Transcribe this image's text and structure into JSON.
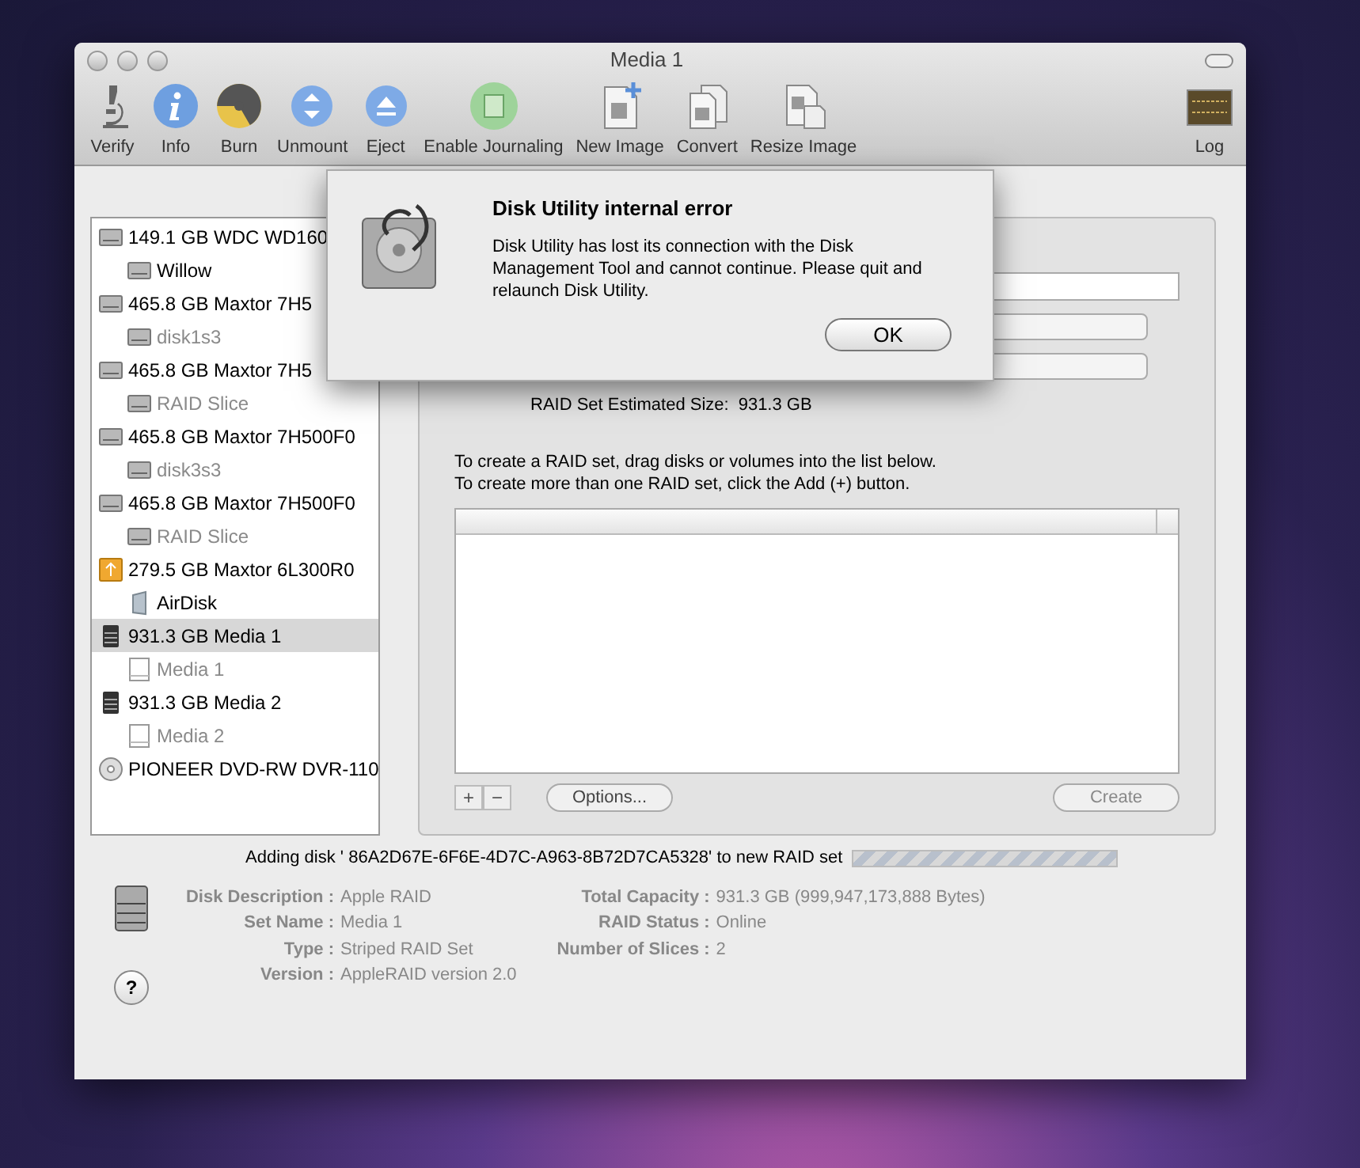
{
  "window": {
    "title": "Media 1"
  },
  "toolbar": [
    {
      "label": "Verify",
      "kind": "microscope"
    },
    {
      "label": "Info",
      "kind": "info"
    },
    {
      "label": "Burn",
      "kind": "burn"
    },
    {
      "label": "Unmount",
      "kind": "unmount"
    },
    {
      "label": "Eject",
      "kind": "eject"
    },
    {
      "label": "Enable Journaling",
      "kind": "journal"
    },
    {
      "label": "New Image",
      "kind": "newimage"
    },
    {
      "label": "Convert",
      "kind": "convert"
    },
    {
      "label": "Resize Image",
      "kind": "resize"
    }
  ],
  "log_button": {
    "label": "Log"
  },
  "sidebar": {
    "items": [
      {
        "label": "149.1 GB WDC WD160",
        "kind": "disk",
        "selected": false,
        "dimmed": false,
        "children": [
          {
            "label": "Willow",
            "kind": "disk",
            "selected": false,
            "dimmed": false
          }
        ]
      },
      {
        "label": "465.8 GB Maxtor 7H5",
        "kind": "disk",
        "selected": false,
        "dimmed": false,
        "children": [
          {
            "label": "disk1s3",
            "kind": "disk",
            "selected": false,
            "dimmed": true
          }
        ]
      },
      {
        "label": "465.8 GB Maxtor 7H5",
        "kind": "disk",
        "selected": false,
        "dimmed": false,
        "children": [
          {
            "label": "RAID Slice",
            "kind": "disk",
            "selected": false,
            "dimmed": true
          }
        ]
      },
      {
        "label": "465.8 GB Maxtor 7H500F0",
        "kind": "disk",
        "selected": false,
        "dimmed": false,
        "children": [
          {
            "label": "disk3s3",
            "kind": "disk",
            "selected": false,
            "dimmed": true
          }
        ]
      },
      {
        "label": "465.8 GB Maxtor 7H500F0",
        "kind": "disk",
        "selected": false,
        "dimmed": false,
        "children": [
          {
            "label": "RAID Slice",
            "kind": "disk",
            "selected": false,
            "dimmed": true
          }
        ]
      },
      {
        "label": "279.5 GB Maxtor 6L300R0",
        "kind": "firewire",
        "selected": false,
        "dimmed": false,
        "children": [
          {
            "label": "AirDisk",
            "kind": "network",
            "selected": false,
            "dimmed": false
          }
        ]
      },
      {
        "label": "931.3 GB Media 1",
        "kind": "raid",
        "selected": true,
        "dimmed": false,
        "children": [
          {
            "label": "Media 1",
            "kind": "volume",
            "selected": false,
            "dimmed": true
          }
        ]
      },
      {
        "label": "931.3 GB Media 2",
        "kind": "raid",
        "selected": false,
        "dimmed": false,
        "children": [
          {
            "label": "Media 2",
            "kind": "volume",
            "selected": false,
            "dimmed": true
          }
        ]
      },
      {
        "label": "PIONEER DVD-RW DVR-110",
        "kind": "optical",
        "selected": false,
        "dimmed": false
      }
    ]
  },
  "raid_panel": {
    "estimated_size_label": "RAID Set Estimated Size:",
    "estimated_size": "931.3 GB",
    "instructions": [
      "To create a RAID set, drag disks or volumes into the list below.",
      "To create more than one RAID set, click the Add (+) button."
    ],
    "add_button": "+",
    "remove_button": "−",
    "options_button": {
      "label": "Options...",
      "disabled": false
    },
    "create_button": {
      "label": "Create",
      "disabled": true
    }
  },
  "dialog": {
    "title": "Disk Utility internal error",
    "message": "Disk Utility has lost its connection with the Disk Management Tool and cannot continue. Please quit and relaunch Disk Utility.",
    "button": "OK"
  },
  "status": {
    "message": "Adding disk ' 86A2D67E-6F6E-4D7C-A963-8B72D7CA5328' to new RAID set",
    "progress": {
      "indeterminate": true
    }
  },
  "info": {
    "left": [
      {
        "label": "Disk Description :",
        "value": "Apple RAID"
      },
      {
        "label": "Set Name :",
        "value": "Media 1"
      },
      {
        "label": "Type :",
        "value": "Striped RAID Set"
      },
      {
        "label": "Version :",
        "value": "AppleRAID version 2.0"
      }
    ],
    "right": [
      {
        "label": "Total Capacity :",
        "value": "931.3 GB (999,947,173,888 Bytes)"
      },
      {
        "label": "RAID Status :",
        "value": "Online"
      },
      {
        "label": "Number of Slices :",
        "value": "2"
      }
    ]
  },
  "help_button": "?"
}
